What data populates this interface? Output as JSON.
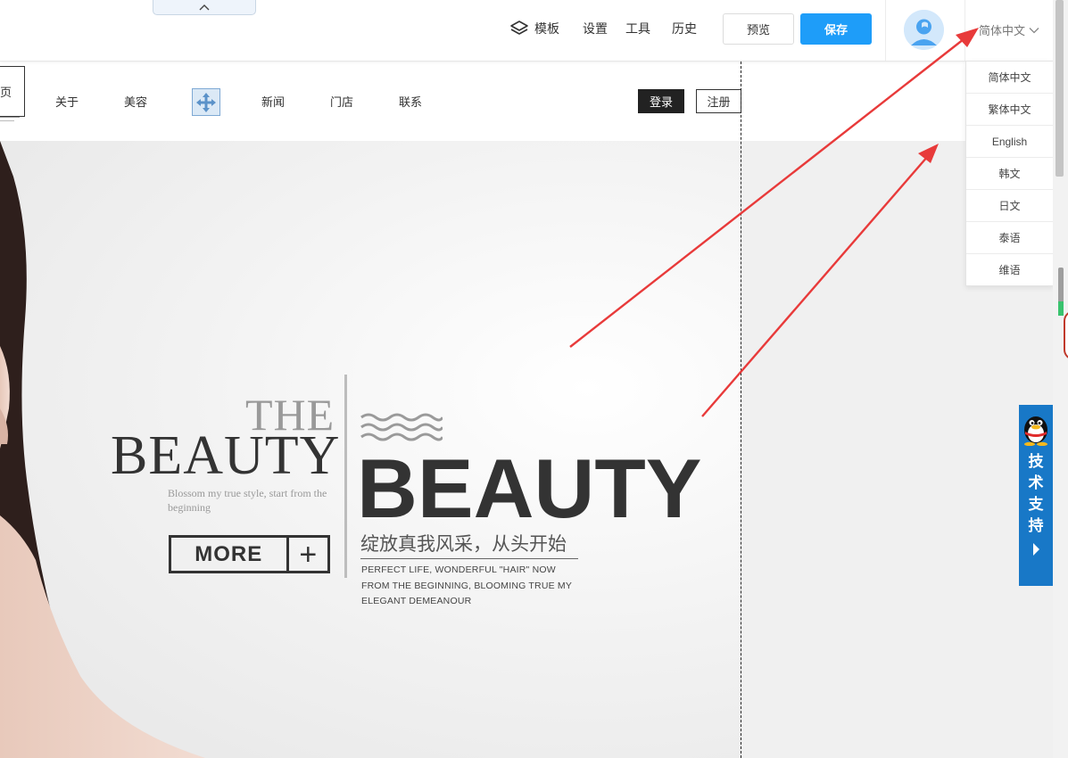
{
  "toolbar": {
    "template_label": "模板",
    "settings_label": "设置",
    "tools_label": "工具",
    "history_label": "历史",
    "preview_label": "预览",
    "save_label": "保存",
    "language_selected": "简体中文",
    "icon_layers": "layers-icon",
    "icon_collapse": "chevron-up-icon",
    "accent_color": "#1e9df9"
  },
  "language_menu": {
    "options": [
      "简体中文",
      "繁体中文",
      "English",
      "韩文",
      "日文",
      "泰语",
      "维语"
    ]
  },
  "site_nav": {
    "active_item": "页",
    "items": [
      "关于",
      "美容",
      "新闻",
      "门店",
      "联系"
    ],
    "login_label": "登录",
    "register_label": "注册"
  },
  "hero": {
    "the_word": "THE",
    "beauty_serif": "BEAUTY",
    "blossom_text": "Blossom my true style, start from the beginning",
    "more_label": "MORE",
    "more_plus": "+",
    "beauty_big": "BEAUTY",
    "cn_slogan": "绽放真我风采，从头开始",
    "en_desc": "PERFECT LIFE, WONDERFUL \"HAIR\" NOW FROM THE BEGINNING, BLOOMING TRUE MY ELEGANT DEMEANOUR"
  },
  "support": {
    "chars": [
      "技",
      "术",
      "支",
      "持"
    ],
    "icon": "qq-penguin-icon",
    "color": "#1878c7"
  },
  "annotation_color": "#e83a3a"
}
